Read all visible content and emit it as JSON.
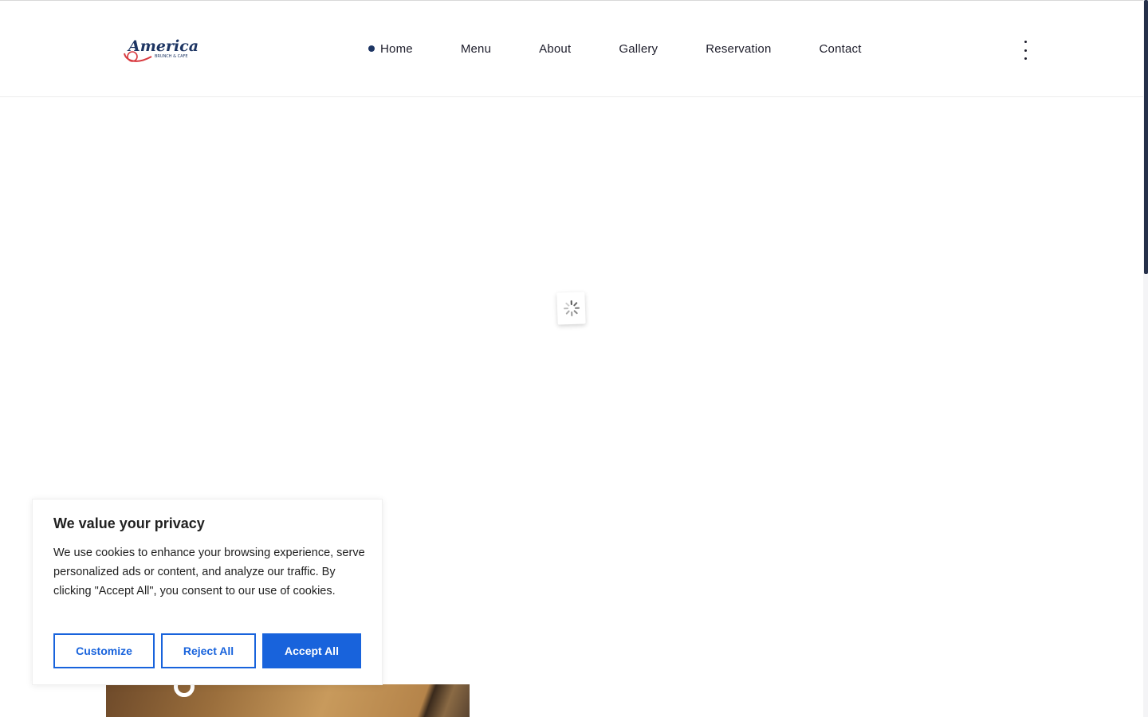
{
  "header": {
    "logo": {
      "text": "Americana",
      "subtext": "BRUNCH & CAFE"
    },
    "nav": [
      {
        "label": "Home",
        "active": true
      },
      {
        "label": "Menu"
      },
      {
        "label": "About"
      },
      {
        "label": "Gallery"
      },
      {
        "label": "Reservation"
      },
      {
        "label": "Contact"
      }
    ],
    "menu_icon": "kebab-vertical-icon"
  },
  "loader": {
    "icon": "spinner-icon"
  },
  "cookie_banner": {
    "title": "We value your privacy",
    "body": "We use cookies to enhance your browsing experience, serve personalized ads or content, and analyze our traffic. By clicking \"Accept All\", you consent to our use of cookies.",
    "buttons": {
      "customize": "Customize",
      "reject": "Reject All",
      "accept": "Accept All"
    }
  },
  "colors": {
    "accent": "#1863dc",
    "brand": "#1d3563"
  }
}
